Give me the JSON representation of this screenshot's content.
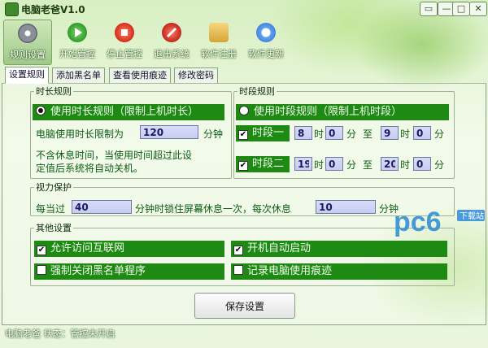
{
  "window": {
    "title": "电脑老爸V1.0",
    "controls": [
      "▭",
      "—",
      "□",
      "✕"
    ]
  },
  "toolbar": {
    "items": [
      {
        "label": "规则设置",
        "icon": "gear-icon",
        "color": "#8a8f9a"
      },
      {
        "label": "开始管控",
        "icon": "play-icon",
        "color": "#2e9b2a"
      },
      {
        "label": "停止管控",
        "icon": "stop-icon",
        "color": "#d62a1c"
      },
      {
        "label": "退出系统",
        "icon": "exit-icon",
        "color": "#c0281c"
      },
      {
        "label": "软件注册",
        "icon": "coins-icon",
        "color": "#d4a63a"
      },
      {
        "label": "软件更新",
        "icon": "refresh-icon",
        "color": "#2c6fd4"
      }
    ]
  },
  "tabs": [
    "设置规则",
    "添加黑名单",
    "查看使用痕迹",
    "修改密码"
  ],
  "duration": {
    "legend": "时长规则",
    "radio_label": "使用时长规则（限制上机时长）",
    "limit_prefix": "电脑使用时长限制为",
    "limit_value": "120",
    "limit_unit": "分钟",
    "note_line1": "不含休息时间，当使用时间超过此设",
    "note_line2": "定值后系统将自动关机。"
  },
  "period": {
    "legend": "时段规则",
    "radio_label": "使用时段规则（限制上机时段）",
    "segments": [
      {
        "label": "时段一",
        "start_h": "8",
        "start_m": "0",
        "end_h": "9",
        "end_m": "0"
      },
      {
        "label": "时段二",
        "start_h": "19",
        "start_m": "0",
        "end_h": "20",
        "end_m": "0"
      }
    ],
    "hour_unit": "时",
    "minute_unit": "分",
    "to": "至"
  },
  "eye": {
    "legend": "视力保护",
    "prefix": "每当过",
    "interval": "40",
    "mid": "分钟时锁住屏幕休息一次，每次休息",
    "rest": "10",
    "unit": "分钟"
  },
  "other": {
    "legend": "其他设置",
    "options": [
      {
        "label": "允许访问互联网",
        "checked": true
      },
      {
        "label": "开机自动启动",
        "checked": true
      },
      {
        "label": "强制关闭黑名单程序",
        "checked": false
      },
      {
        "label": "记录电脑使用痕迹",
        "checked": false
      }
    ]
  },
  "save_label": "保存设置",
  "status": "电脑老爸 状态：管控未开启",
  "watermark": {
    "logo": "pc6",
    "tag": "下载站"
  }
}
